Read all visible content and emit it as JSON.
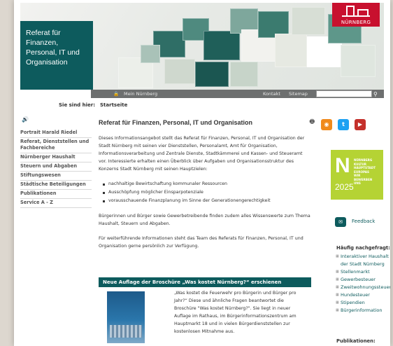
{
  "header": {
    "title_lines": [
      "Referat für",
      "Finanzen,",
      "Personal, IT und",
      "Organisation"
    ],
    "logo_text": "NÜRNBERG"
  },
  "navbar": {
    "mein": "Mein Nürnberg",
    "kontakt": "Kontakt",
    "sitemap": "Sitemap",
    "search_value": ""
  },
  "breadcrumb": {
    "label": "Sie sind hier:",
    "current": "Startseite"
  },
  "sidebar": {
    "items": [
      "Portrait Harald Riedel",
      "Referat, Dienststellen und Fachbereiche",
      "Nürnberger Haushalt",
      "Steuern und Abgaben",
      "Stiftungswesen",
      "Städtische Beteiligungen",
      "Publikationen",
      "Service A - Z"
    ]
  },
  "main": {
    "heading": "Referat für Finanzen, Personal, IT und Organisation",
    "intro": "Dieses Informationsangebot stellt das Referat für Finanzen, Personal, IT und Organisation der Stadt Nürnberg mit seinen vier Dienststellen, Personalamt, Amt für Organisation, Informationsverarbeitung und Zentrale Dienste, Stadtkämmerei und Kassen- und Steueramt vor. Interessierte erhalten einen Überblick über Aufgaben und Organisationsstruktur des Konzerns Stadt Nürnberg mit seinen Hauptzielen:",
    "bullets": [
      "nachhaltige Bewirtschaftung kommunaler Ressourcen",
      "Ausschöpfung möglicher Einsparpotenziale",
      "vorausschauende Finanzplanung im Sinne der Generationengerechtigkeit"
    ],
    "para2": "Bürgerinnen und Bürger sowie Gewerbetreibende finden zudem alles Wissenswerte zum Thema Haushalt, Steuern und Abgaben.",
    "para3": "Für weiterführende Informationen steht das Team des Referats für Finanzen, Personal, IT und Organisation gerne persönlich zur Verfügung."
  },
  "teaser": {
    "heading": "Neue Auflage der Broschüre „Was kostet Nürnberg?“ erschienen",
    "text": "„Was kostet die Feuerwehr pro Bürgerin und Bürger pro Jahr?“ Diese und ähnliche Fragen beantwortet die Broschüre \"Was kostet Nürnberg?\". Sie liegt in neuer Auflage im Rathaus, im Bürgerinformationszentrum am Hauptmarkt 18 und in vielen Bürgerdienststellen zur kostenlosen Mitnahme aus."
  },
  "right": {
    "kult_year": "2025",
    "kult_text": [
      "NÜRNBERG",
      "KULTUR",
      "HAUPTSTADT",
      "EUROPAS",
      "WIR",
      "BEWERBEN",
      "UNS"
    ],
    "feedback": "Feedback",
    "often_heading": "Häufig nachgefragt:",
    "often_links": [
      "Interaktiver Haushalt der Stadt Nürnberg",
      "Stellenmarkt",
      "Gewerbesteuer",
      "Zweitwohnungssteuer",
      "Hundesteuer",
      "Stipendien",
      "Bürgerinformation"
    ],
    "pub_heading": "Publikationen:"
  },
  "colors": {
    "accent": "#0d5b5d",
    "logo": "#c8102e",
    "kultur": "#b5d334"
  },
  "icons": [
    "lock-icon",
    "search-icon",
    "speaker-icon",
    "print-icon",
    "rss-icon",
    "twitter-icon",
    "youtube-icon",
    "feedback-icon"
  ]
}
